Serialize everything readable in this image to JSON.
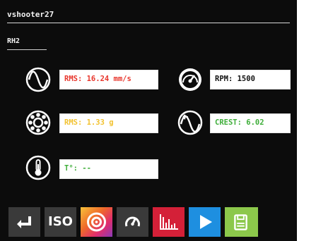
{
  "header": {
    "title": "vshooter27"
  },
  "tab": {
    "label": "RH2"
  },
  "metrics": {
    "velocity_rms": {
      "text": "RMS: 16.24 mm/s",
      "color": "#e8362c",
      "icon": "sine-wave-icon"
    },
    "rpm": {
      "text": "RPM: 1500",
      "color": "#111111",
      "icon": "speedometer-icon"
    },
    "accel_rms": {
      "text": "RMS: 1.33 g",
      "color": "#f2c230",
      "icon": "bearing-icon"
    },
    "crest": {
      "text": "CREST: 6.02",
      "color": "#3fae3a",
      "icon": "crest-factor-icon"
    },
    "temperature": {
      "text": "T°: --",
      "color": "#3fae3a",
      "icon": "thermometer-icon"
    }
  },
  "toolbar": {
    "buttons": [
      {
        "icon": "enter-icon",
        "color": "#3a3a3a"
      },
      {
        "label": "ISO",
        "color": "#3a3a3a"
      },
      {
        "icon": "target-icon",
        "color": "gradient-orange-purple"
      },
      {
        "icon": "gauge-icon",
        "color": "#3a3a3a"
      },
      {
        "icon": "spectrum-icon",
        "color": "#d42038"
      },
      {
        "icon": "play-icon",
        "color": "#1e8fe0"
      },
      {
        "icon": "save-report-icon",
        "color": "#8cc84b"
      }
    ]
  }
}
